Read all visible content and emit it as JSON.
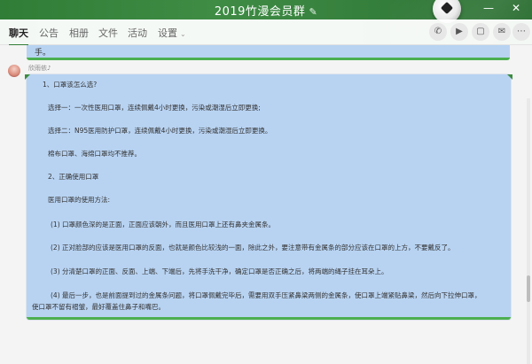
{
  "window": {
    "title": "2019竹漫会员群",
    "edit_icon": "edit-icon",
    "min_label": "—",
    "close_label": "✕"
  },
  "tabs": [
    {
      "label": "聊天",
      "active": true
    },
    {
      "label": "公告"
    },
    {
      "label": "相册"
    },
    {
      "label": "文件"
    },
    {
      "label": "活动"
    },
    {
      "label": "设置",
      "chevron": "⌄"
    }
  ],
  "toolbar_icons": [
    {
      "name": "phone-icon",
      "glyph": "✆"
    },
    {
      "name": "video-icon",
      "glyph": "▶"
    },
    {
      "name": "screen-share-icon",
      "glyph": "▢"
    },
    {
      "name": "message-icon",
      "glyph": "✉"
    },
    {
      "name": "more-icon",
      "glyph": "⋯"
    }
  ],
  "chat": {
    "previous_tail": "手。",
    "sender_name": "欣雨依♪",
    "message_lines": [
      "1、口罩该怎么选?",
      "选择一：一次性医用口罩，连续佩戴4小时更换，污染或潮湿后立即更换;",
      "选择二：N95医用防护口罩，连续佩戴4小时更换，污染或潮湿后立即更换。",
      "棉布口罩、海绵口罩均不推荐。",
      "2、正确使用口罩",
      "医用口罩的使用方法:",
      "(1) 口罩颜色深的是正面，正面应该朝外，而且医用口罩上还有鼻夹金属条。",
      "(2) 正对脸部的应该是医用口罩的反面，也就是颜色比较浅的一面，除此之外，要注意带有金属条的部分应该在口罩的上方，不要戴反了。",
      "(3) 分清楚口罩的正面、反面、上端、下端后，先将手洗干净，确定口罩是否正确之后，将两端的绳子挂在耳朵上。",
      "(4) 最后一步，也是前面提到过的金属条问题，将口罩佩戴完毕后，需要用双手压紧鼻梁两侧的金属条，使口罩上端紧贴鼻梁，然后向下拉伸口罩，",
      "使口罩不留有褶皱，最好覆盖住鼻子和嘴巴。"
    ]
  },
  "colors": {
    "header_green": "#2f7d36",
    "bubble_blue": "#b8d3f2",
    "bubble_border": "#4caf50"
  }
}
